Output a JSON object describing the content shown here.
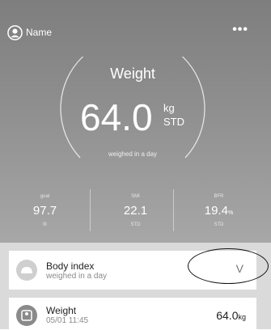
{
  "header": {
    "user_name": "Name",
    "more_label": "•••"
  },
  "gauge": {
    "title": "Weight",
    "value": "64.0",
    "unit": "kg",
    "unit_sub": "STD",
    "subtitle": "weighed in a day"
  },
  "stats": [
    {
      "label": "goal",
      "value": "97.7",
      "unit": "",
      "sub": "fit"
    },
    {
      "label": "SMI",
      "value": "22.1",
      "unit": "",
      "sub": "STD"
    },
    {
      "label": "BFR",
      "value": "19.4",
      "unit": "%",
      "sub": "STD"
    }
  ],
  "list": {
    "body_index": {
      "title": "Body index",
      "subtitle": "weighed in a day",
      "chevron": "V"
    },
    "weight": {
      "title": "Weight",
      "date": "05/01 11:45",
      "value": "64.0",
      "unit": "kg"
    }
  },
  "colors": {
    "header_top": "#7e7e7e",
    "header_bottom": "#a7a7a7",
    "list_bg": "#dadada"
  }
}
